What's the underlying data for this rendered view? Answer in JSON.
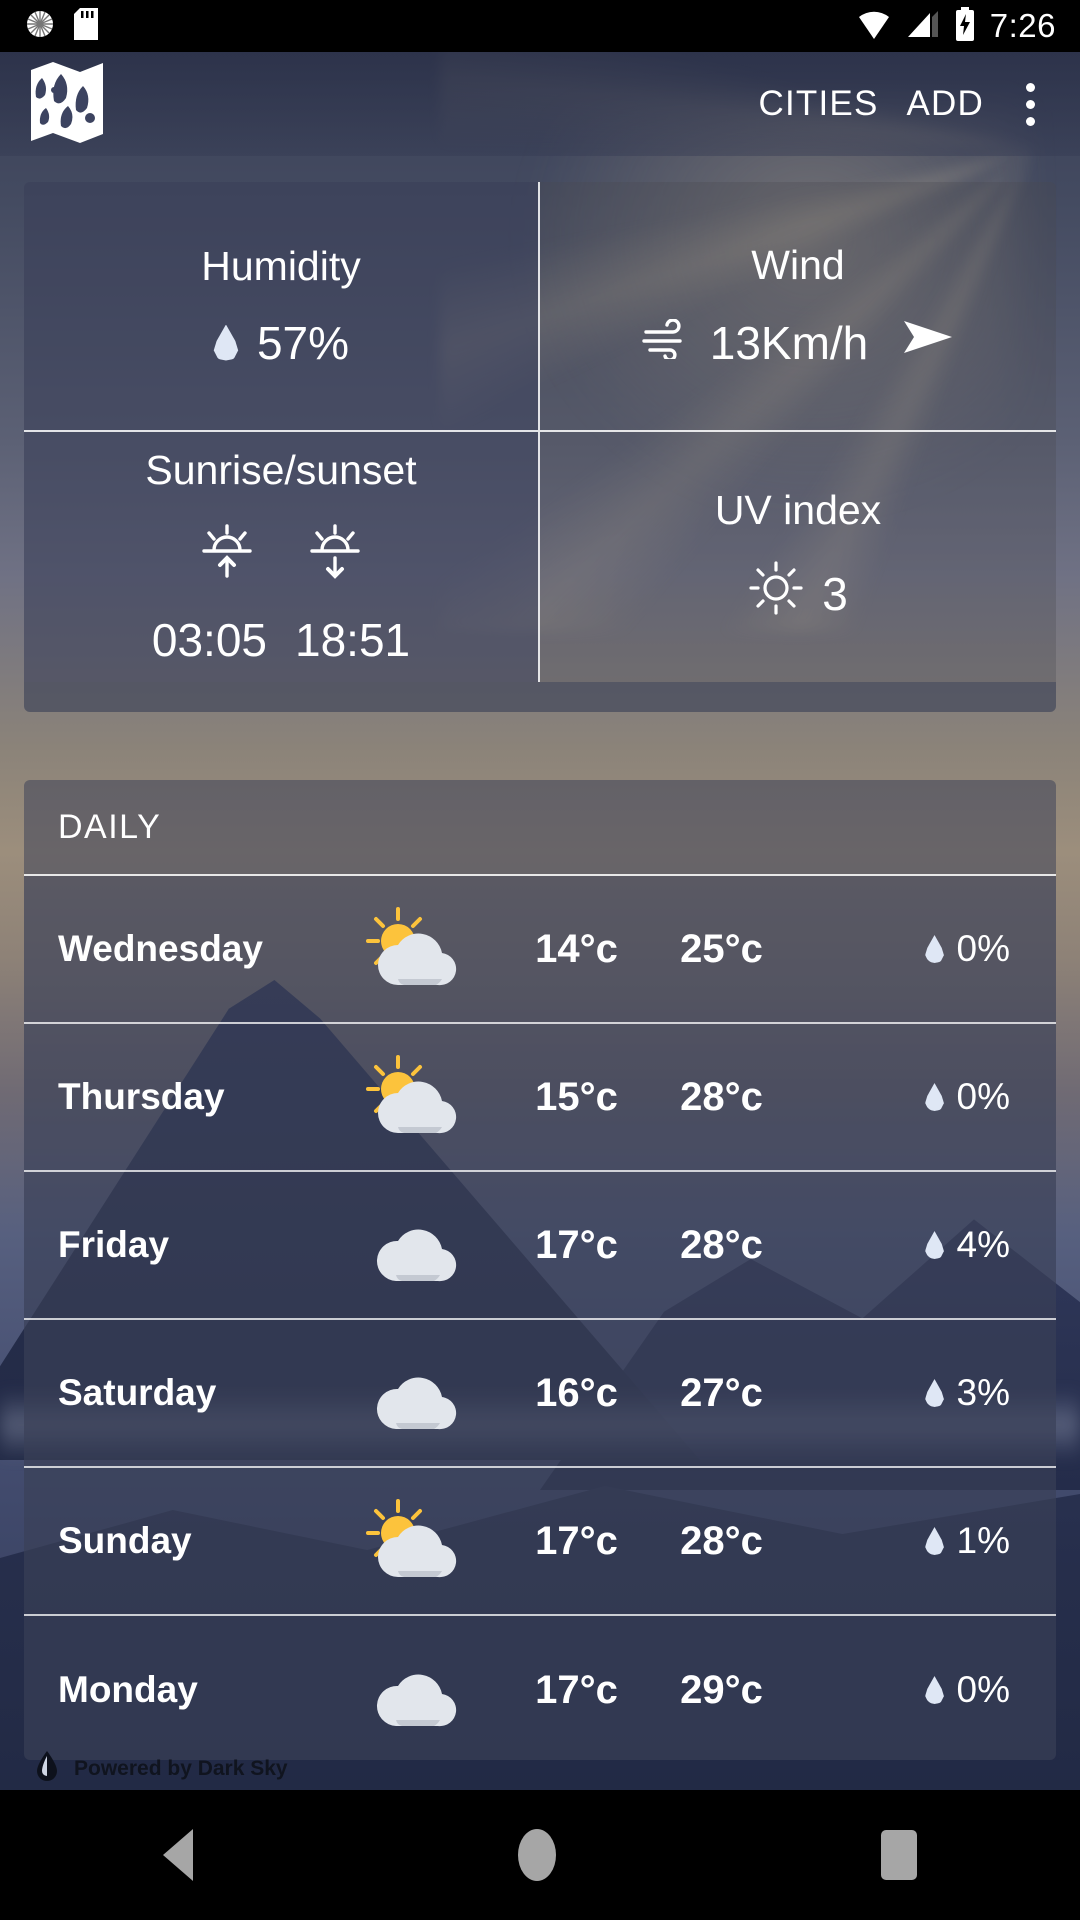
{
  "statusbar": {
    "time": "7:26",
    "icons": [
      "brightness-icon",
      "sd-card-icon",
      "wifi-icon",
      "signal-icon",
      "battery-charging-icon"
    ]
  },
  "appbar": {
    "logo": "map-icon",
    "cities_label": "CITIES",
    "add_label": "ADD",
    "overflow": "more-options-icon"
  },
  "details": {
    "humidity": {
      "title": "Humidity",
      "value": "57%",
      "icon": "water-drop-icon"
    },
    "wind": {
      "title": "Wind",
      "value": "13Km/h",
      "icon": "wind-icon",
      "direction_icon": "arrow-direction-icon"
    },
    "sun": {
      "title": "Sunrise/sunset",
      "sunrise": "03:05",
      "sunset": "18:51",
      "sunrise_icon": "sunrise-icon",
      "sunset_icon": "sunset-icon"
    },
    "uv": {
      "title": "UV index",
      "value": "3",
      "icon": "sun-icon"
    }
  },
  "daily": {
    "header": "DAILY",
    "rows": [
      {
        "day": "Wednesday",
        "icon": "partly-cloudy-icon",
        "low": "14°c",
        "high": "25°c",
        "precip": "0%"
      },
      {
        "day": "Thursday",
        "icon": "partly-cloudy-icon",
        "low": "15°c",
        "high": "28°c",
        "precip": "0%"
      },
      {
        "day": "Friday",
        "icon": "cloudy-icon",
        "low": "17°c",
        "high": "28°c",
        "precip": "4%"
      },
      {
        "day": "Saturday",
        "icon": "cloudy-icon",
        "low": "16°c",
        "high": "27°c",
        "precip": "3%"
      },
      {
        "day": "Sunday",
        "icon": "partly-cloudy-icon",
        "low": "17°c",
        "high": "28°c",
        "precip": "1%"
      },
      {
        "day": "Monday",
        "icon": "cloudy-icon",
        "low": "17°c",
        "high": "29°c",
        "precip": "0%"
      }
    ]
  },
  "footer": {
    "attribution": "Powered by Dark Sky",
    "icon": "dark-sky-logo-icon"
  },
  "navbar": {
    "back": "back-nav-icon",
    "home": "home-nav-icon",
    "recents": "recents-nav-icon"
  },
  "colors": {
    "sun_yellow": "#FCC33C",
    "cloud_grey": "#D9DDE3",
    "drop_blue": "#DFE7F5",
    "accent_white": "#FFFFFF"
  }
}
